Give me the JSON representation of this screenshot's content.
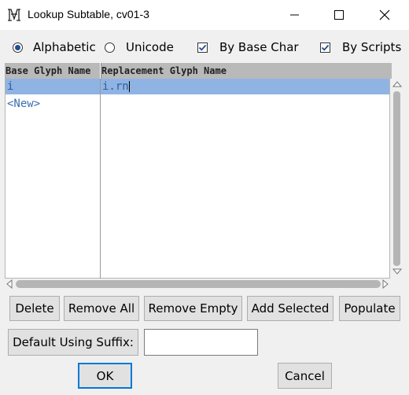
{
  "window": {
    "title": "Lookup Subtable, cv01-3"
  },
  "options": {
    "alphabetic": "Alphabetic",
    "unicode": "Unicode",
    "by_base_char": "By Base Char",
    "by_scripts": "By Scripts",
    "selected_sort": "Alphabetic",
    "by_base_char_checked": true,
    "by_scripts_checked": true
  },
  "table": {
    "headers": [
      "Base Glyph Name",
      "Replacement Glyph Name"
    ],
    "rows": [
      {
        "base": "i",
        "replacement": "i.rn"
      }
    ],
    "new_label": "<New>"
  },
  "buttons": {
    "delete": "Delete",
    "remove_all": "Remove All",
    "remove_empty": "Remove Empty",
    "add_selected": "Add Selected",
    "populate": "Populate",
    "default_suffix": "Default Using Suffix:",
    "ok": "OK",
    "cancel": "Cancel"
  },
  "suffix_field": {
    "value": ""
  },
  "colors": {
    "selection": "#8fb4e3",
    "header": "#b9b9b9",
    "text_blue": "#3a6fb0"
  },
  "icons": [
    "app-icon",
    "minimize-icon",
    "maximize-icon",
    "close-icon",
    "scroll-up-icon",
    "scroll-down-icon",
    "scroll-left-icon",
    "scroll-right-icon",
    "check-icon"
  ]
}
